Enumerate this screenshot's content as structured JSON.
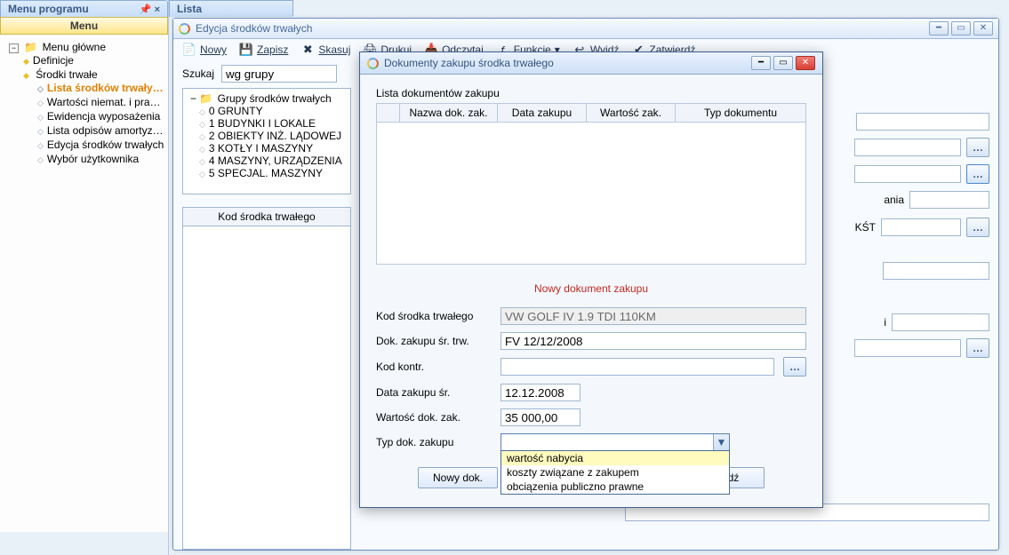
{
  "left_panel": {
    "tab_title": "Menu programu",
    "menu_heading": "Menu",
    "items": {
      "root": "Menu główne",
      "level1": [
        {
          "label": "Definicje"
        },
        {
          "label": "Środki trwałe"
        }
      ],
      "srodki_children": [
        "Lista środków trwałych",
        "Wartości niemat. i prawne",
        "Ewidencja wyposażenia",
        "Lista odpisów amortyzacyjnych",
        "Edycja środków trwałych",
        "Wybór użytkownika"
      ]
    }
  },
  "lista_tab": "Lista",
  "edit_window": {
    "title": "Edycja środków trwałych",
    "toolbar": {
      "nowy": "Nowy",
      "zapisz": "Zapisz",
      "skasuj": "Skasuj",
      "drukuj": "Drukuj",
      "odczytaj": "Odczytaj",
      "funkcje": "Funkcje",
      "wyjdz": "Wyjdź",
      "zatwierdz": "Zatwierdź"
    },
    "search_label": "Szukaj",
    "search_value": "wg grupy",
    "group_root": "Grupy środków trwałych",
    "groups": [
      "0 GRUNTY",
      "1 BUDYNKI I LOKALE",
      "2 OBIEKTY INŻ. LĄDOWEJ",
      "3 KOTŁY I MASZYNY",
      "4 MASZYNY, URZĄDZENIA",
      "5 SPECJAL. MASZYNY"
    ],
    "kod_header": "Kod środka trwałego",
    "rhs_labels": {
      "ania": "ania",
      "kst": "KŚT",
      "i": "i"
    }
  },
  "modal": {
    "title": "Dokumenty zakupu środka trwałego",
    "list_label": "Lista dokumentów zakupu",
    "cols": {
      "nazwa": "Nazwa dok. zak.",
      "data": "Data zakupu",
      "wartosc": "Wartość zak.",
      "typ": "Typ dokumentu"
    },
    "section_heading": "Nowy dokument zakupu",
    "form": {
      "kod_label": "Kod środka trwałego",
      "kod_value": "VW GOLF IV 1.9 TDI 110KM",
      "dok_label": "Dok. zakupu śr. trw.",
      "dok_value": "FV 12/12/2008",
      "kontr_label": "Kod kontr.",
      "kontr_value": "",
      "data_label": "Data zakupu śr.",
      "data_value": "12.12.2008",
      "wart_label": "Wartość dok. zak.",
      "wart_value": "35 000,00",
      "typ_label": "Typ dok. zakupu",
      "typ_options": [
        "wartość nabycia",
        "koszty związane z zakupem",
        "obciązenia publiczno prawne"
      ]
    },
    "buttons": {
      "nowy": "Nowy dok.",
      "wyjdz": "Wyjdź"
    }
  }
}
